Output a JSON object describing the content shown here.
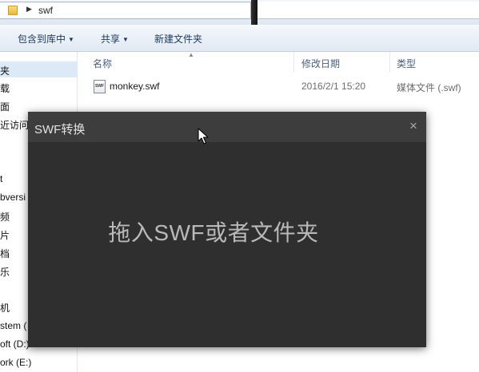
{
  "address_bar": {
    "path": "swf"
  },
  "toolbar": {
    "include_library": "包含到库中",
    "share": "共享",
    "new_folder": "新建文件夹"
  },
  "nav": {
    "items": [
      "夹",
      "载",
      "面",
      "近访问",
      "t",
      "bversi",
      "频",
      "片",
      "档",
      "乐",
      "机",
      "stem (",
      "oft (D:)",
      "ork (E:)"
    ]
  },
  "file_list": {
    "columns": {
      "name": "名称",
      "modified": "修改日期",
      "type": "类型"
    },
    "rows": [
      {
        "name": "monkey.swf",
        "modified": "2016/2/1 15:20",
        "type": "媒体文件 (.swf)",
        "icon_label": "SWF"
      }
    ]
  },
  "dialog": {
    "title": "SWF转换",
    "close_glyph": "×",
    "drop_text": "拖入SWF或者文件夹"
  },
  "colors": {
    "dialog_bg": "#2f2f2f",
    "dialog_title_bg": "#3d3d3d",
    "dialog_text": "#b9b9b9",
    "toolbar_text": "#1e395b"
  },
  "icons": [
    "folder-icon",
    "chevron-right-icon",
    "chevron-down-icon",
    "swf-file-icon",
    "close-icon",
    "cursor-arrow-icon"
  ]
}
